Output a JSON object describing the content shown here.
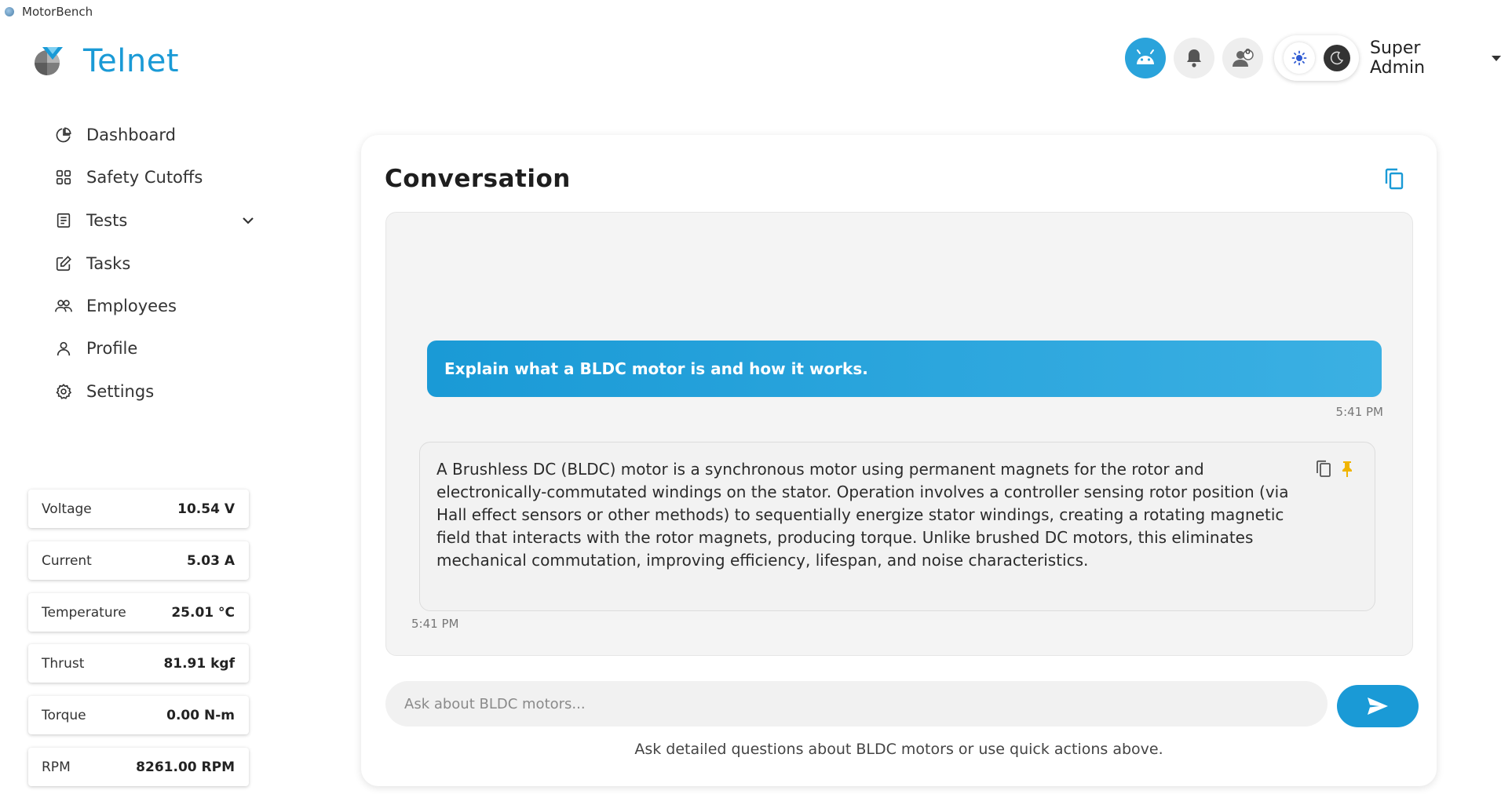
{
  "window": {
    "title": "MotorBench"
  },
  "brand": {
    "name": "Telnet",
    "accent": "#1a9ad6"
  },
  "sidebar": {
    "items": [
      {
        "label": "Dashboard",
        "icon": "pie-chart-icon"
      },
      {
        "label": "Safety Cutoffs",
        "icon": "grid-icon"
      },
      {
        "label": "Tests",
        "icon": "clipboard-icon",
        "expandable": true
      },
      {
        "label": "Tasks",
        "icon": "edit-icon"
      },
      {
        "label": "Employees",
        "icon": "users-icon"
      },
      {
        "label": "Profile",
        "icon": "user-icon"
      },
      {
        "label": "Settings",
        "icon": "gear-icon"
      }
    ]
  },
  "metrics": [
    {
      "label": "Voltage",
      "value": "10.54 V"
    },
    {
      "label": "Current",
      "value": "5.03 A"
    },
    {
      "label": "Temperature",
      "value": "25.01 °C"
    },
    {
      "label": "Thrust",
      "value": "81.91 kgf"
    },
    {
      "label": "Torque",
      "value": "0.00 N-m"
    },
    {
      "label": "RPM",
      "value": "8261.00 RPM"
    }
  ],
  "header": {
    "user_name": "Super Admin",
    "icons": [
      "android-icon",
      "bell-icon",
      "user-badge-icon",
      "sun-icon",
      "moon-icon"
    ],
    "user_badge_count": "0"
  },
  "conversation": {
    "title": "Conversation",
    "messages": [
      {
        "role": "user",
        "text": "Explain what a BLDC motor is and how it works.",
        "time": "5:41 PM"
      },
      {
        "role": "assistant",
        "text": "A Brushless DC (BLDC) motor is a synchronous motor using permanent magnets for the rotor and electronically-commutated windings on the stator.  Operation involves a controller sensing rotor position (via Hall effect sensors or other methods) to sequentially energize stator windings, creating a rotating magnetic field that interacts with the rotor magnets, producing torque.  Unlike brushed DC motors, this eliminates mechanical commutation, improving efficiency, lifespan, and noise characteristics.",
        "time": "5:41 PM"
      }
    ],
    "input": {
      "placeholder": "Ask about BLDC motors...",
      "value": ""
    },
    "helper_text": "Ask detailed questions about BLDC motors or use quick actions above."
  }
}
